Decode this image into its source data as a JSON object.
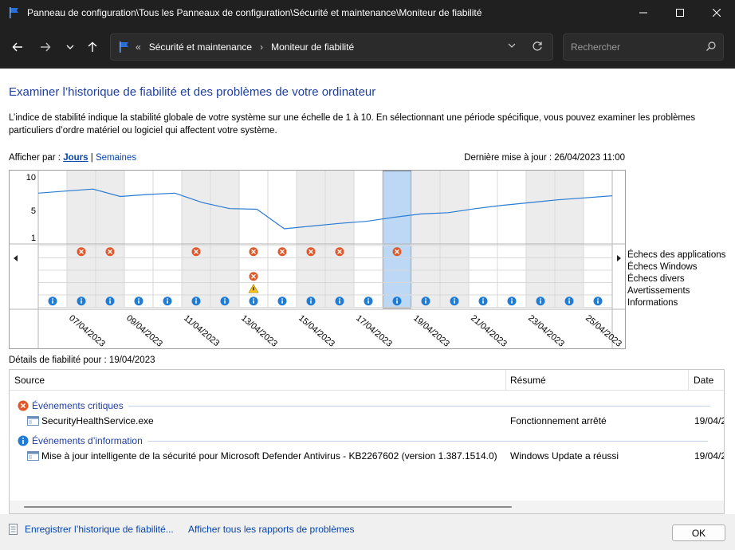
{
  "window": {
    "title": "Panneau de configuration\\Tous les Panneaux de configuration\\Sécurité et maintenance\\Moniteur de fiabilité"
  },
  "address": {
    "overflow": "«",
    "crumbs": [
      "Sécurité et maintenance",
      "Moniteur de fiabilité"
    ],
    "search_placeholder": "Rechercher"
  },
  "page": {
    "heading": "Examiner l’historique de fiabilité et des problèmes de votre ordinateur",
    "description": "L’indice de stabilité indique la stabilité globale de votre système sur une échelle de 1 à 10. En sélectionnant une période spécifique, vous pouvez examiner les problèmes particuliers d’ordre matériel ou logiciel qui affectent votre système.",
    "view_by_label": "Afficher par :",
    "view_days": "Jours",
    "view_sep": "|",
    "view_weeks": "Semaines",
    "last_update": "Dernière mise à jour : 26/04/2023 11:00"
  },
  "chart_data": {
    "type": "line",
    "y_ticks": [
      "10",
      "5",
      "1"
    ],
    "ylim": [
      1,
      10
    ],
    "x_labels": [
      "07/04/2023",
      "09/04/2023",
      "11/04/2023",
      "13/04/2023",
      "15/04/2023",
      "17/04/2023",
      "19/04/2023",
      "21/04/2023",
      "23/04/2023",
      "25/04/2023"
    ],
    "days": [
      "06/04",
      "07/04",
      "08/04",
      "09/04",
      "10/04",
      "11/04",
      "12/04",
      "13/04",
      "14/04",
      "15/04",
      "16/04",
      "17/04",
      "18/04",
      "19/04",
      "20/04",
      "21/04",
      "22/04",
      "23/04",
      "24/04",
      "25/04"
    ],
    "selected_day_index": 12,
    "stability_series": [
      7.6,
      7.9,
      8.2,
      7.1,
      7.4,
      7.6,
      6.2,
      5.3,
      5.2,
      2.3,
      2.7,
      3.1,
      3.4,
      4.0,
      4.5,
      4.7,
      5.3,
      5.8,
      6.2,
      6.6,
      6.9,
      7.2
    ],
    "rows": [
      "Échecs des applications",
      "Échecs Windows",
      "Échecs divers",
      "Avertissements",
      "Informations"
    ],
    "app_failures": [
      1,
      2,
      5,
      7,
      8,
      9,
      10,
      12
    ],
    "misc_failures": [
      7
    ],
    "warnings": [
      7
    ],
    "informations": [
      0,
      1,
      2,
      3,
      4,
      5,
      6,
      7,
      8,
      9,
      10,
      11,
      12,
      13,
      14,
      15,
      16,
      17,
      18,
      19
    ],
    "colors": {
      "line": "#2a7bd3",
      "selection": "#bcd8f4",
      "weekend": "#ececec",
      "error": "#e0582a",
      "info": "#1e7bd6",
      "warning": "#f2c21b"
    }
  },
  "details": {
    "title": "Détails de fiabilité pour : 19/04/2023",
    "col_source": "Source",
    "col_summary": "Résumé",
    "col_date": "Date",
    "groups": [
      {
        "label": "Événements critiques",
        "icon": "error-icon",
        "rows": [
          {
            "source": "SecurityHealthService.exe",
            "summary": "Fonctionnement arrêté",
            "date": "19/04/2"
          }
        ]
      },
      {
        "label": "Événements d’information",
        "icon": "info-icon",
        "rows": [
          {
            "source": "Mise à jour intelligente de la sécurité pour Microsoft Defender Antivirus - KB2267602 (version 1.387.1514.0)",
            "summary": "Windows Update a réussi",
            "date": "19/04/2"
          }
        ]
      }
    ]
  },
  "footer": {
    "save_link": "Enregistrer l’historique de fiabilité...",
    "all_reports_link": "Afficher tous les rapports de problèmes",
    "ok": "OK"
  }
}
